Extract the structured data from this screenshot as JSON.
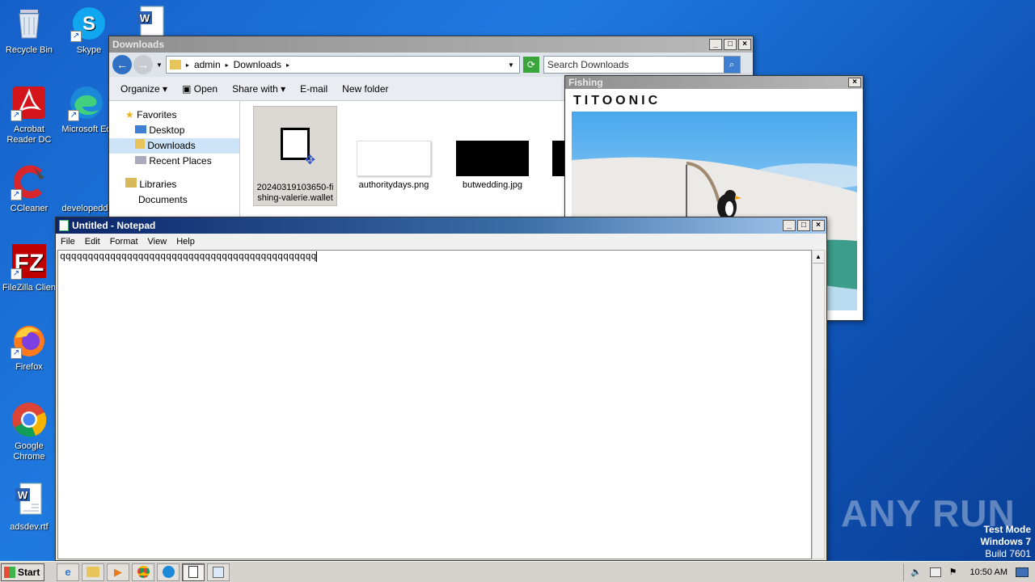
{
  "desktop": {
    "icons": [
      {
        "label": "Recycle Bin"
      },
      {
        "label": "Skype"
      },
      {
        "label": "Acrobat Reader DC"
      },
      {
        "label": "Microsoft Ed"
      },
      {
        "label": "CCleaner"
      },
      {
        "label": "developedd"
      },
      {
        "label": "FileZilla Clien"
      },
      {
        "label": "Firefox"
      },
      {
        "label": "Google Chrome"
      },
      {
        "label": "adsdev.rtf"
      }
    ],
    "watermark": {
      "brand": "ANY RUN",
      "mode": "Test Mode",
      "os": "Windows 7",
      "build": "Build 7601"
    }
  },
  "explorer": {
    "title": "Downloads",
    "breadcrumb": [
      "admin",
      "Downloads"
    ],
    "search_placeholder": "Search Downloads",
    "toolbar": {
      "organize": "Organize",
      "open": "Open",
      "share": "Share with",
      "email": "E-mail",
      "new_folder": "New folder"
    },
    "nav": {
      "favorites": "Favorites",
      "desktop": "Desktop",
      "downloads": "Downloads",
      "recent": "Recent Places",
      "libraries": "Libraries",
      "documents": "Documents"
    },
    "files": [
      {
        "name": "20240319103650-fishing-valerie.wallet",
        "line1": "20240319103650-fi",
        "line2": "shing-valerie.wallet"
      },
      {
        "name": "authoritydays.png"
      },
      {
        "name": "butwedding.jpg"
      }
    ]
  },
  "fishing": {
    "title": "Fishing",
    "logo": "TITOONIC"
  },
  "notepad": {
    "title": "Untitled - Notepad",
    "menu": {
      "file": "File",
      "edit": "Edit",
      "format": "Format",
      "view": "View",
      "help": "Help"
    },
    "content": "qqqqqqqqqqqqqqqqqqqqqqqqqqqqqqqqqqqqqqqqqqqqqq"
  },
  "taskbar": {
    "start": "Start",
    "clock": "10:50 AM"
  }
}
